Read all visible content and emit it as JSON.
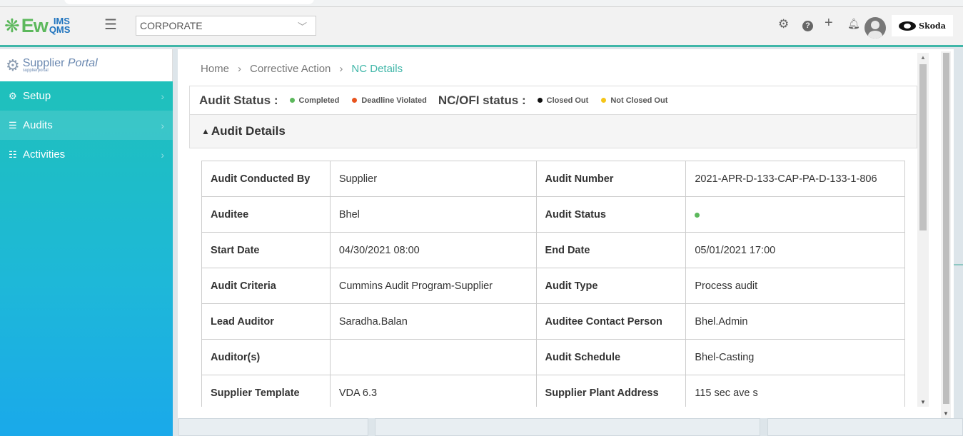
{
  "header": {
    "org_select_value": "CORPORATE",
    "brand_name": "Skoda"
  },
  "sidebar": {
    "portal_title": "Supplier",
    "portal_title_italic": "Portal",
    "portal_subtitle": "supplierportal",
    "items": [
      {
        "label": "Setup"
      },
      {
        "label": "Audits"
      },
      {
        "label": "Activities"
      }
    ]
  },
  "breadcrumb": [
    "Home",
    "Corrective Action",
    "NC Details"
  ],
  "status_bar": {
    "audit_status_label": "Audit Status :",
    "audit_legend": [
      {
        "label": "Completed",
        "color": "#5cb85c"
      },
      {
        "label": "Deadline Violated",
        "color": "#e8541e"
      }
    ],
    "nc_status_label": "NC/OFI status :",
    "nc_legend": [
      {
        "label": "Closed Out",
        "color": "#111111"
      },
      {
        "label": "Not Closed Out",
        "color": "#f5c518"
      }
    ]
  },
  "section_title": "Audit Details",
  "details": [
    {
      "k1": "Audit Conducted By",
      "v1": "Supplier",
      "k2": "Audit Number",
      "v2": "2021-APR-D-133-CAP-PA-D-133-1-806"
    },
    {
      "k1": "Auditee",
      "v1": "Bhel",
      "k2": "Audit Status",
      "v2": ""
    },
    {
      "k1": "Start Date",
      "v1": "04/30/2021 08:00",
      "k2": "End Date",
      "v2": "05/01/2021 17:00"
    },
    {
      "k1": "Audit Criteria",
      "v1": "Cummins Audit Program-Supplier",
      "k2": "Audit Type",
      "v2": "Process audit"
    },
    {
      "k1": "Lead Auditor",
      "v1": "Saradha.Balan",
      "k2": "Auditee Contact Person",
      "v2": "Bhel.Admin"
    },
    {
      "k1": "Auditor(s)",
      "v1": "",
      "k2": "Audit Schedule",
      "v2": "Bhel-Casting"
    },
    {
      "k1": "Supplier Template",
      "v1": "VDA 6.3",
      "k2": "Supplier Plant Address",
      "v2": "115 sec ave s"
    }
  ],
  "colors": {
    "accent": "#3fb6a8",
    "audit_status_completed": "#5cb85c"
  }
}
